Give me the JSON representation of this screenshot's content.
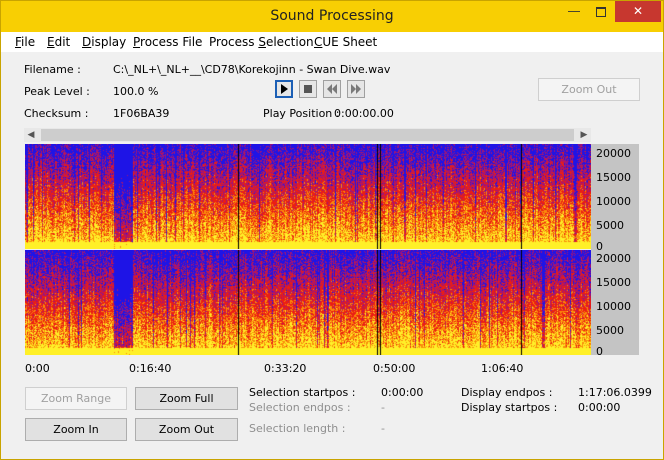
{
  "window": {
    "title": "Sound Processing"
  },
  "menu": [
    "File",
    "Edit",
    "Display",
    "Process File",
    "Process Selection",
    "CUE Sheet"
  ],
  "menu_access_keys": [
    "F",
    "E",
    "D",
    "P",
    "S",
    "C"
  ],
  "info": {
    "filename_label": "Filename :",
    "filename_value": "C:\\_NL+\\_NL+__\\CD78\\Korekojinn - Swan Dive.wav",
    "peak_label": "Peak Level :",
    "peak_value": "100.0 %",
    "checksum_label": "Checksum :",
    "checksum_value": "1F06BA39",
    "play_position_label": "Play Position :",
    "play_position_value": "0:00:00.00"
  },
  "buttons": {
    "zoom_out_top": "Zoom Out",
    "zoom_range": "Zoom Range",
    "zoom_full": "Zoom Full",
    "zoom_in": "Zoom In",
    "zoom_out": "Zoom Out"
  },
  "frequency_ticks": [
    "20000",
    "15000",
    "10000",
    "5000",
    "0"
  ],
  "time_ticks": [
    "0:00",
    "0:16:40",
    "0:33:20",
    "0:50:00",
    "1:06:40"
  ],
  "selection": {
    "startpos_label": "Selection startpos :",
    "startpos_value": "0:00:00",
    "endpos_label": "Selection endpos :",
    "endpos_value": "-",
    "length_label": "Selection length :",
    "length_value": "-"
  },
  "display": {
    "endpos_label": "Display endpos :",
    "endpos_value": "1:17:06.0399",
    "startpos_label": "Display startpos :",
    "startpos_value": "0:00:00"
  },
  "colors": {
    "titlebar": "#f8cf03",
    "close_button": "#c7372f",
    "spectrum_low": "#0000ff",
    "spectrum_mid": "#ff0000",
    "spectrum_high": "#ffff00"
  }
}
